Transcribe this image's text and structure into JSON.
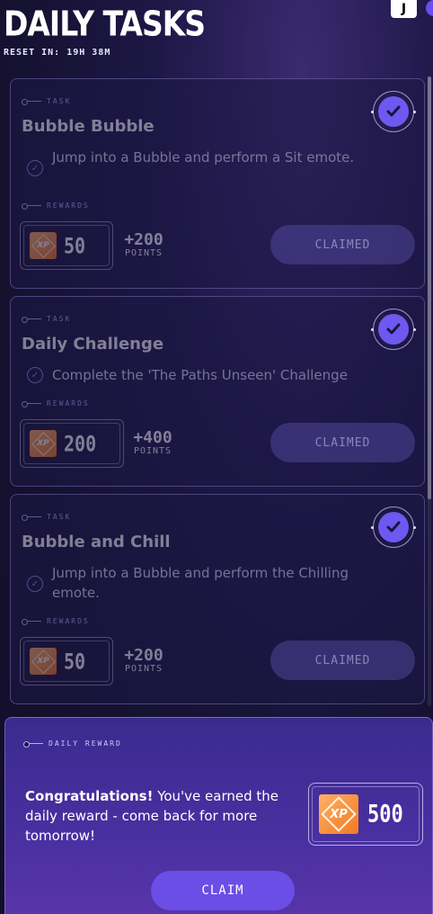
{
  "header": {
    "title": "DAILY TASKS",
    "reset_text": "RESET IN: 19H 38M",
    "avatar_initial": "J"
  },
  "labels": {
    "task": "TASK",
    "rewards": "REWARDS"
  },
  "tasks": [
    {
      "name": "Bubble Bubble",
      "description": "Jump into a Bubble and perform a Sit emote.",
      "xp": "50",
      "points_value": "+200",
      "points_label": "POINTS",
      "button_label": "CLAIMED",
      "completed": true
    },
    {
      "name": "Daily Challenge",
      "description": "Complete the 'The Paths Unseen' Challenge",
      "xp": "200",
      "points_value": "+400",
      "points_label": "POINTS",
      "button_label": "CLAIMED",
      "completed": true
    },
    {
      "name": "Bubble and Chill",
      "description": "Jump into a Bubble and perform the Chilling emote.",
      "xp": "50",
      "points_value": "+200",
      "points_label": "POINTS",
      "button_label": "CLAIMED",
      "completed": true
    }
  ],
  "daily_reward": {
    "label": "DAILY REWARD",
    "congrats_bold": "Congratulations!",
    "congrats_text": " You've earned the daily reward - come back for more tomorrow!",
    "xp": "500",
    "claim_label": "CLAIM"
  },
  "icons": {
    "xp_icon_text": "XP"
  },
  "colors": {
    "accent": "#6a4ee6",
    "check_fill": "#6e58f0",
    "xp_orange": "#f07a22",
    "label_purple": "#b6acff"
  }
}
